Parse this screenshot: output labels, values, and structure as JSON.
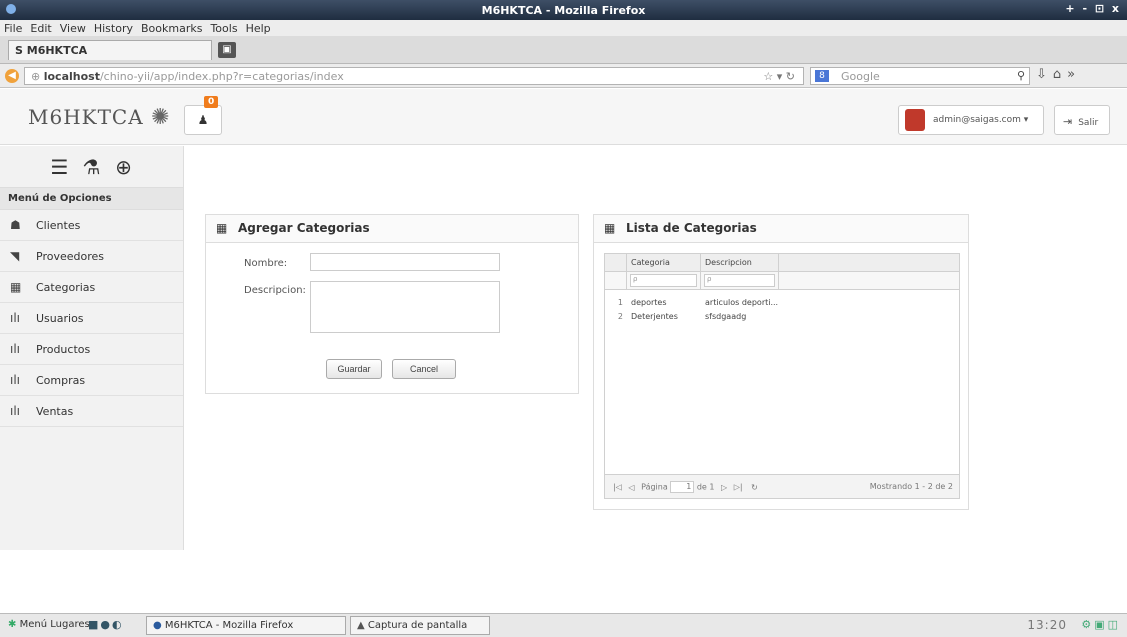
{
  "window": {
    "title": "M6HKTCA - Mozilla Firefox",
    "controls": "+ - ⊡ x"
  },
  "menubar": [
    "File",
    "Edit",
    "View",
    "History",
    "Bookmarks",
    "Tools",
    "Help"
  ],
  "tab": {
    "title": "S M6HKTCA"
  },
  "nav": {
    "url_host": "localhost",
    "url_path": "/chino-yii/app/index.php?r=categorias/index",
    "search_placeholder": "Google"
  },
  "header": {
    "brand": "M6HKTCA",
    "notification_count": "0",
    "user_email": "admin@saigas.com ▾",
    "logout_label": "Salir"
  },
  "sidebar": {
    "title": "Menú de Opciones",
    "items": [
      {
        "label": "Clientes",
        "icon": "users-icon",
        "glyph": "☗"
      },
      {
        "label": "Proveedores",
        "icon": "rss-icon",
        "glyph": "◥"
      },
      {
        "label": "Categorias",
        "icon": "calendar-icon",
        "glyph": "▦"
      },
      {
        "label": "Usuarios",
        "icon": "chart-icon",
        "glyph": "ılı"
      },
      {
        "label": "Productos",
        "icon": "chart-icon",
        "glyph": "ılı"
      },
      {
        "label": "Compras",
        "icon": "chart-icon",
        "glyph": "ılı"
      },
      {
        "label": "Ventas",
        "icon": "chart-icon",
        "glyph": "ılı"
      }
    ]
  },
  "form_panel": {
    "title": "Agregar Categorias",
    "nombre_label": "Nombre:",
    "nombre_value": "",
    "descripcion_label": "Descripcion:",
    "descripcion_value": "",
    "save_label": "Guardar",
    "cancel_label": "Cancel"
  },
  "list_panel": {
    "title": "Lista de Categorias",
    "columns": [
      "Categoria",
      "Descripcion"
    ],
    "filter_placeholder": "ρ",
    "rows": [
      {
        "n": "1",
        "categoria": "deportes",
        "descripcion": "articulos deporti..."
      },
      {
        "n": "2",
        "categoria": "Deterjentes",
        "descripcion": "sfsdgaadg"
      }
    ],
    "pager": {
      "page_label": "Página",
      "page_value": "1",
      "of_label": "de 1",
      "showing": "Mostrando 1 - 2 de 2"
    }
  },
  "taskbar": {
    "menu": "Menú",
    "places": "Lugares",
    "task1": "M6HKTCA - Mozilla Firefox",
    "task2": "Captura de pantalla",
    "clock": "13:20"
  }
}
